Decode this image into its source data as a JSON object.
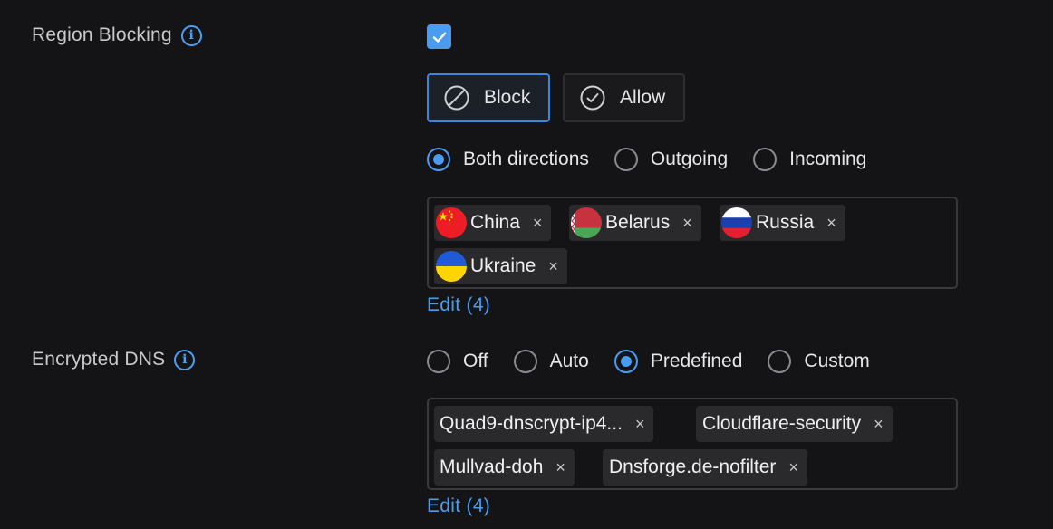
{
  "region_blocking": {
    "label": "Region Blocking",
    "enabled": true,
    "mode_buttons": [
      {
        "label": "Block",
        "selected": true,
        "icon": "block-icon"
      },
      {
        "label": "Allow",
        "selected": false,
        "icon": "check-circle-icon"
      }
    ],
    "direction_options": [
      {
        "label": "Both directions",
        "selected": true
      },
      {
        "label": "Outgoing",
        "selected": false
      },
      {
        "label": "Incoming",
        "selected": false
      }
    ],
    "countries": [
      {
        "label": "China",
        "flag": "china-flag-icon"
      },
      {
        "label": "Belarus",
        "flag": "belarus-flag-icon"
      },
      {
        "label": "Russia",
        "flag": "russia-flag-icon"
      },
      {
        "label": "Ukraine",
        "flag": "ukraine-flag-icon"
      }
    ],
    "remove_glyph": "×",
    "edit_label": "Edit (4)"
  },
  "encrypted_dns": {
    "label": "Encrypted DNS",
    "options": [
      {
        "label": "Off",
        "selected": false
      },
      {
        "label": "Auto",
        "selected": false
      },
      {
        "label": "Predefined",
        "selected": true
      },
      {
        "label": "Custom",
        "selected": false
      }
    ],
    "servers": [
      {
        "label": "Quad9-dnscrypt-ip4..."
      },
      {
        "label": "Cloudflare-security"
      },
      {
        "label": "Mullvad-doh"
      },
      {
        "label": "Dnsforge.de-nofilter"
      }
    ],
    "remove_glyph": "×",
    "edit_label": "Edit (4)"
  },
  "colors": {
    "accent": "#4a9cf0",
    "background": "#141416",
    "chip": "#2a2a2d",
    "border": "#3a3a3e"
  }
}
